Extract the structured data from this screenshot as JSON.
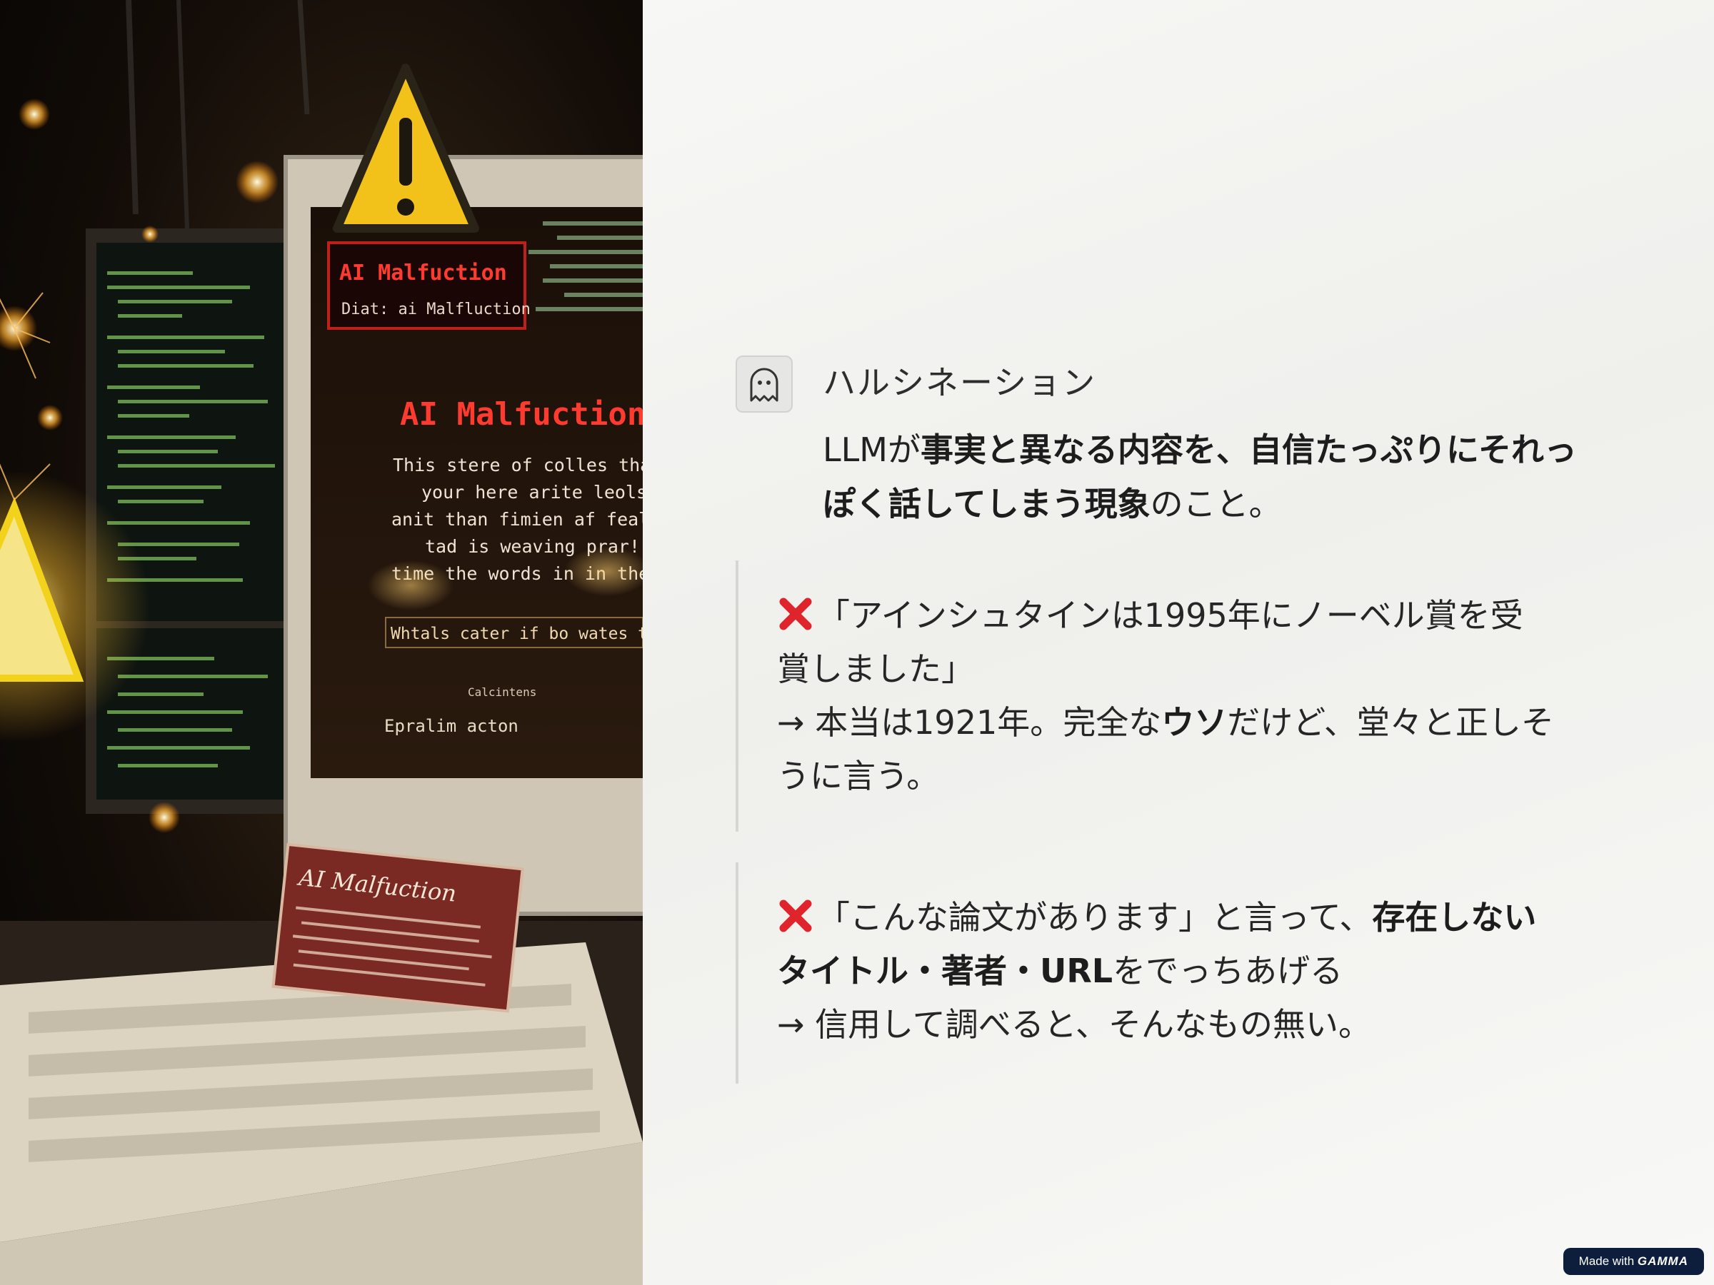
{
  "photo": {
    "screen_title": "AI Malfuction",
    "screen_subtitle": "Diat: ai Malfluction",
    "screen_heading": "AI Malfuction",
    "screen_lines": [
      "This stere of colles thalread,",
      "your here arite leols",
      "anit than fimien af fealleeated",
      "tad is weaving prar!",
      "time the words in in thelimeates"
    ],
    "screen_prompt": "Whtals cater if bo wates to lupe!",
    "screen_small": "Calcintens",
    "screen_action": "Epralim acton",
    "card_title": "AI Malfuction"
  },
  "callout": {
    "icon": "ghost-icon",
    "title": "ハルシネーション",
    "body_prefix": "LLMが",
    "body_bold": "事実と異なる内容を、自信たっぷりにそれっぽく話してしまう現象",
    "body_suffix": "のこと。"
  },
  "examples": [
    {
      "icon": "cross-mark-icon",
      "line1": "「アインシュタインは1995年にノーベル賞を受賞しました」",
      "line2_prefix": "→ 本当は1921年。完全な",
      "line2_bold": "ウソ",
      "line2_suffix": "だけど、堂々と正しそうに言う。"
    },
    {
      "icon": "cross-mark-icon",
      "line1_prefix": "「こんな論文があります」と言って、",
      "line1_bold": "存在しないタイトル・著者・URL",
      "line1_suffix": "をでっちあげる",
      "line2": "→ 信用して調べると、そんなもの無い。"
    }
  ],
  "badge": {
    "prefix": "Made with",
    "brand": "GAMMA"
  },
  "colors": {
    "cross": "#e0242c",
    "screen_red": "#ff3b2f",
    "warning_yellow": "#f2c21b",
    "badge_bg": "#0d1e3c"
  }
}
